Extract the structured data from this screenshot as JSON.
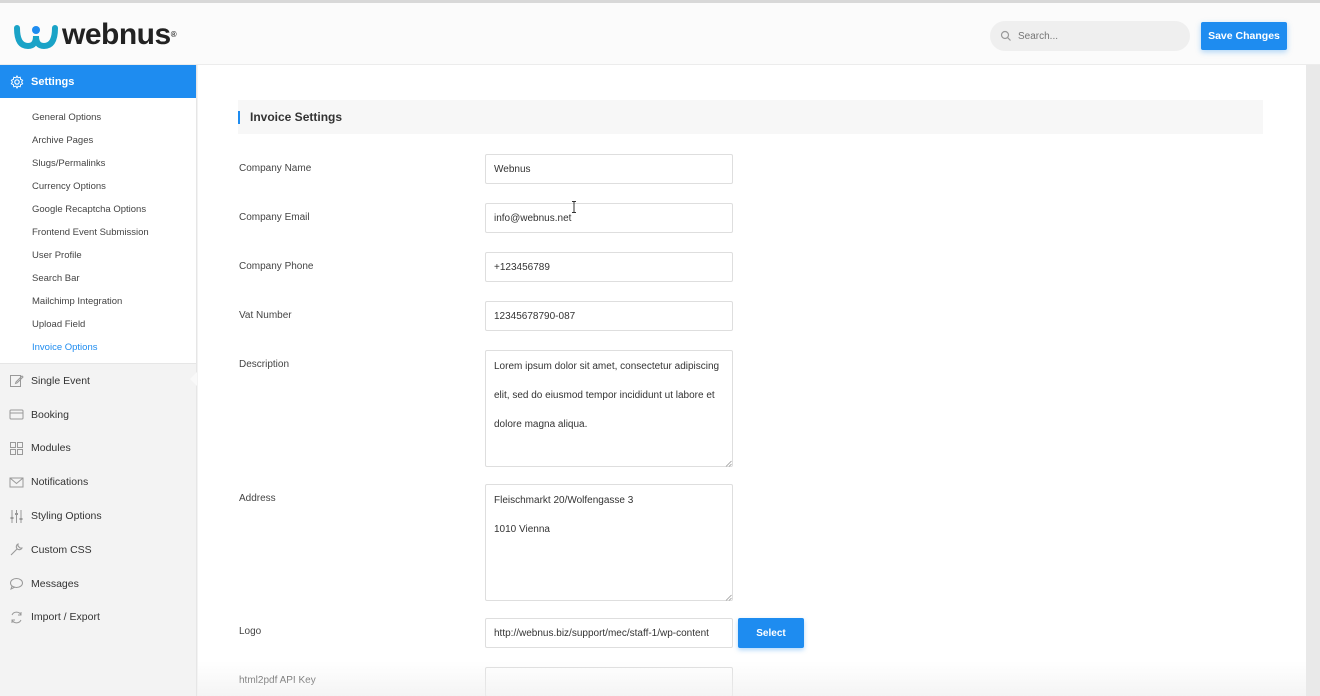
{
  "header": {
    "logo_text": "webnus",
    "logo_reg": "®",
    "search_placeholder": "Search...",
    "save_label": "Save Changes"
  },
  "sidebar": {
    "active": {
      "label": "Settings",
      "icon": "gear-icon"
    },
    "submenu": [
      {
        "label": "General Options"
      },
      {
        "label": "Archive Pages"
      },
      {
        "label": "Slugs/Permalinks"
      },
      {
        "label": "Currency Options"
      },
      {
        "label": "Google Recaptcha Options"
      },
      {
        "label": "Frontend Event Submission"
      },
      {
        "label": "User Profile"
      },
      {
        "label": "Search Bar"
      },
      {
        "label": "Mailchimp Integration"
      },
      {
        "label": "Upload Field"
      },
      {
        "label": "Invoice Options"
      }
    ],
    "items": [
      {
        "label": "Single Event",
        "icon": "edit-icon"
      },
      {
        "label": "Booking",
        "icon": "card-icon"
      },
      {
        "label": "Modules",
        "icon": "grid-icon"
      },
      {
        "label": "Notifications",
        "icon": "mail-icon"
      },
      {
        "label": "Styling Options",
        "icon": "sliders-icon"
      },
      {
        "label": "Custom CSS",
        "icon": "wrench-icon"
      },
      {
        "label": "Messages",
        "icon": "chat-icon"
      },
      {
        "label": "Import / Export",
        "icon": "sync-icon"
      }
    ]
  },
  "main": {
    "section_title": "Invoice Settings",
    "fields": {
      "company_name": {
        "label": "Company Name",
        "value": "Webnus"
      },
      "company_email": {
        "label": "Company Email",
        "value": "info@webnus.net"
      },
      "company_phone": {
        "label": "Company Phone",
        "value": "+123456789"
      },
      "vat_number": {
        "label": "Vat Number",
        "value": "12345678790-087"
      },
      "description": {
        "label": "Description",
        "value": "Lorem ipsum dolor sit amet, consectetur adipiscing elit, sed do eiusmod tempor incididunt ut labore et dolore magna aliqua."
      },
      "address": {
        "label": "Address",
        "value": "Fleischmarkt 20/Wolfengasse 3\n1010 Vienna"
      },
      "logo": {
        "label": "Logo",
        "value": "http://webnus.biz/support/mec/staff-1/wp-content",
        "button": "Select"
      },
      "html2pdf": {
        "label": "html2pdf API Key",
        "value": ""
      }
    }
  },
  "colors": {
    "accent": "#1e8cf0"
  }
}
